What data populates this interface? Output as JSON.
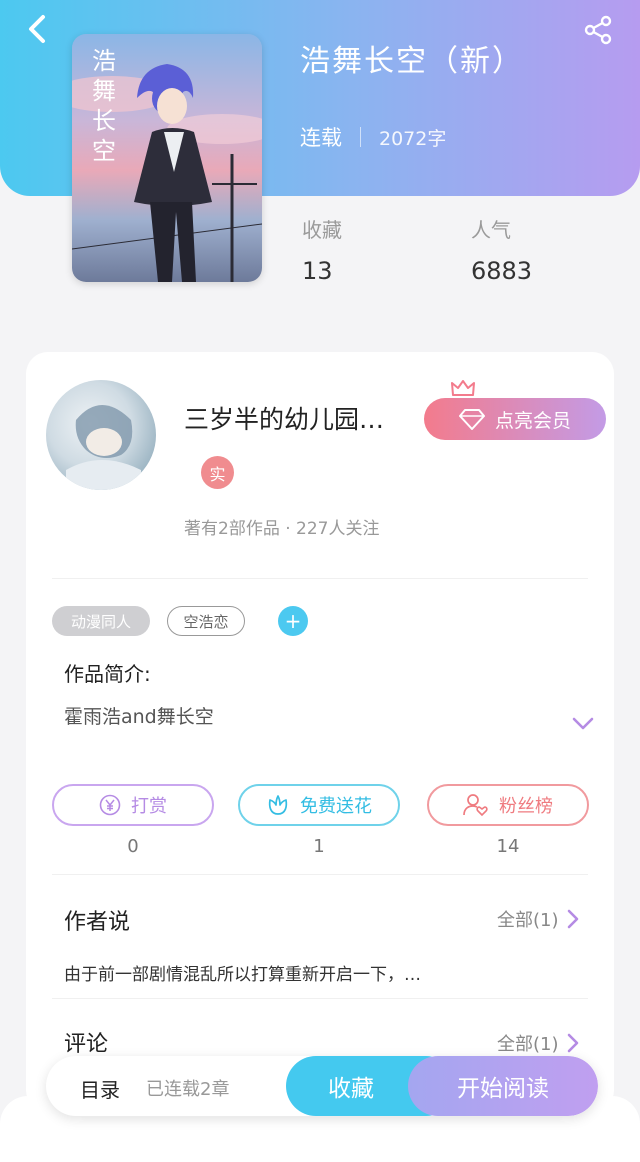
{
  "header": {
    "title": "浩舞长空（新）",
    "status": "连载",
    "word_count": "2072字",
    "stats": [
      {
        "label": "收藏",
        "value": "13"
      },
      {
        "label": "人气",
        "value": "6883"
      }
    ],
    "cover_text": "浩舞长空"
  },
  "author": {
    "name": "三岁半的幼儿园…",
    "badge": "实",
    "meta": "著有2部作品 · 227人关注",
    "vip_button": "点亮会员"
  },
  "tags": [
    "动漫同人",
    "空浩恋"
  ],
  "intro": {
    "label": "作品简介:",
    "text": "霍雨浩and舞长空"
  },
  "actions": [
    {
      "label": "打赏",
      "count": "0",
      "icon": "yen-icon"
    },
    {
      "label": "免费送花",
      "count": "1",
      "icon": "flower-icon"
    },
    {
      "label": "粉丝榜",
      "count": "14",
      "icon": "fan-icon"
    }
  ],
  "author_note": {
    "title": "作者说",
    "all": "全部(1)",
    "text": "由于前一部剧情混乱所以打算重新开启一下，…"
  },
  "comments": {
    "title": "评论",
    "all": "全部(1)"
  },
  "bottom": {
    "toc": "目录",
    "chapters": "已连载2章",
    "collect": "收藏",
    "read": "开始阅读"
  },
  "colors": {
    "header_start": "#4cc9f0",
    "header_end": "#b69cf0",
    "accent_blue": "#44c9ef",
    "accent_purple": "#c09ff0",
    "vip_pink": "#f37b8c"
  }
}
